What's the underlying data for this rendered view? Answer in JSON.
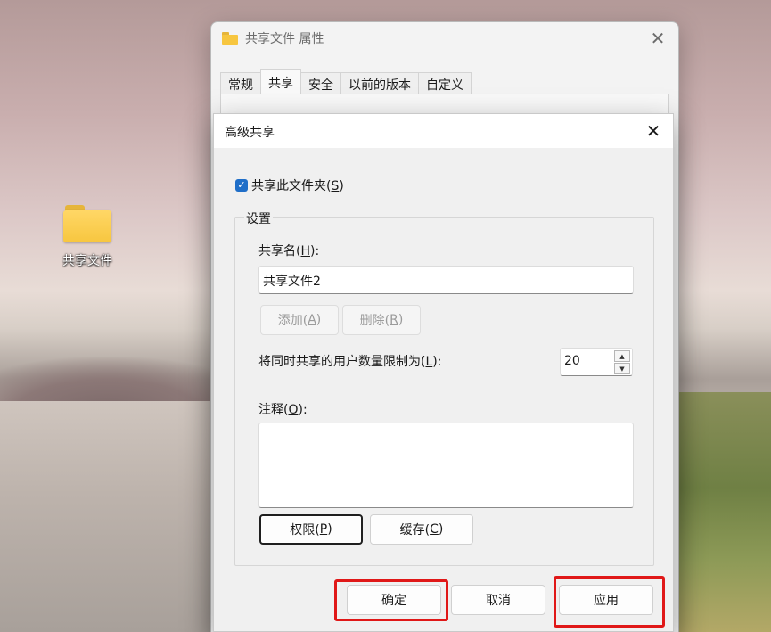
{
  "desktop": {
    "icon_label": "共享文件"
  },
  "properties_window": {
    "title": "共享文件 属性",
    "tabs": [
      "常规",
      "共享",
      "安全",
      "以前的版本",
      "自定义"
    ],
    "active_tab": "共享"
  },
  "advanced_sharing": {
    "title": "高级共享",
    "share_checkbox": {
      "label_prefix": "共享此文件夹(",
      "mnemonic": "S",
      "label_suffix": ")",
      "checked": true
    },
    "settings_group": "设置",
    "share_name": {
      "label_prefix": "共享名(",
      "mnemonic": "H",
      "label_suffix": "):",
      "value": "共享文件2"
    },
    "add_button": {
      "prefix": "添加(",
      "mnemonic": "A",
      "suffix": ")"
    },
    "remove_button": {
      "prefix": "删除(",
      "mnemonic": "R",
      "suffix": ")"
    },
    "user_limit": {
      "label_prefix": "将同时共享的用户数量限制为(",
      "mnemonic": "L",
      "label_suffix": "):",
      "value": "20"
    },
    "comments": {
      "label_prefix": "注释(",
      "mnemonic": "O",
      "label_suffix": "):"
    },
    "permissions_button": {
      "prefix": "权限(",
      "mnemonic": "P",
      "suffix": ")"
    },
    "caching_button": {
      "prefix": "缓存(",
      "mnemonic": "C",
      "suffix": ")"
    },
    "ok_button": "确定",
    "cancel_button": "取消",
    "apply_button": "应用"
  },
  "colors": {
    "highlight": "#e01818",
    "checkbox": "#1f6ec8",
    "folder": "#f7c63f"
  }
}
